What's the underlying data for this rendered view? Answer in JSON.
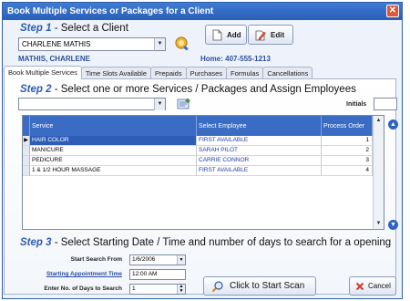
{
  "window": {
    "title": "Book Multiple Services or Packages for a Client",
    "close_glyph": "✕"
  },
  "step1": {
    "num": "Step 1",
    "text": "Select a Client"
  },
  "client": {
    "selected": "CHARLENE MATHIS",
    "name": "MATHIS, CHARLENE",
    "phone": "Home: 407-555-1213"
  },
  "buttons": {
    "add": "Add",
    "edit": "Edit",
    "scan": "Click to Start Scan",
    "cancel": "Cancel"
  },
  "tabs": [
    "Book Multiple Services",
    "Time Slots Available",
    "Prepaids",
    "Purchases",
    "Formulas",
    "Cancellations"
  ],
  "step2": {
    "num": "Step 2",
    "text": "Select one or more Services / Packages and Assign Employees"
  },
  "initials_label": "Initials",
  "grid": {
    "headers": [
      "Service",
      "Select Employee",
      "Process Order"
    ],
    "rows": [
      {
        "service": "HAIR COLOR",
        "employee": "FIRST AVAILABLE",
        "order": "1"
      },
      {
        "service": "MANICURE",
        "employee": "SARAH PILOT",
        "order": "2"
      },
      {
        "service": "PEDICURE",
        "employee": "CARRIE CONNOR",
        "order": "3"
      },
      {
        "service": "1 & 1/2 HOUR MASSAGE",
        "employee": "FIRST AVAILABLE",
        "order": "4"
      }
    ]
  },
  "step3": {
    "num": "Step 3",
    "text": "Select Starting Date / Time and number of days to search for a opening"
  },
  "fields": {
    "start_from_label": "Start Search From",
    "start_from_value": "1/6/2006",
    "start_time_label": "Starting Appointment Time",
    "start_time_value": "12:00 AM",
    "days_label": "Enter No. of Days to Search",
    "days_value": "1"
  },
  "colors": {
    "accent": "#2d5db5",
    "titlebar": "#3f7bd4",
    "grid_header": "#3a6cc3",
    "selection": "#2e5db8"
  }
}
